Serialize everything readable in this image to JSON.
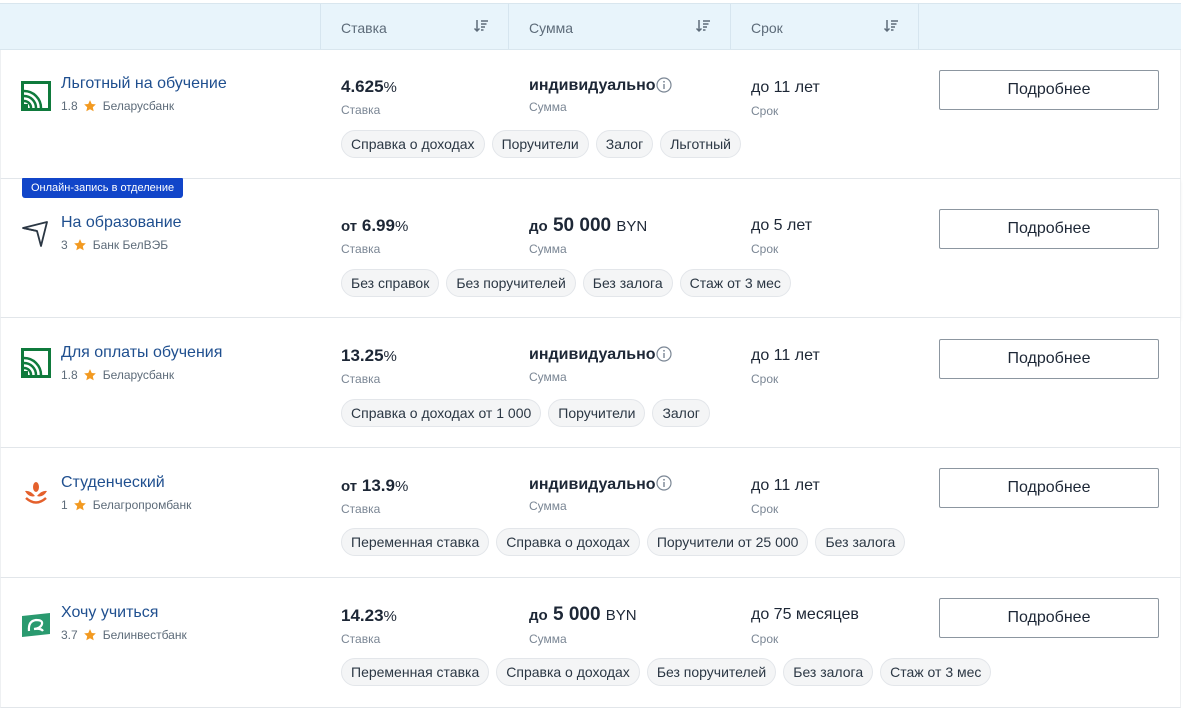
{
  "header": {
    "rate_label": "Ставка",
    "sum_label": "Сумма",
    "term_label": "Срок"
  },
  "colors": {
    "accent_blue": "#1145c9",
    "link_blue": "#1f4f8f",
    "header_bg": "#e8f4fb",
    "star": "#f29a21"
  },
  "rows": [
    {
      "name": "Льготный на обучение",
      "rating": "1.8",
      "bank": "Беларусбанк",
      "logo": "belarusbank-logo",
      "rate_prefix": "",
      "rate_value": "4.625",
      "rate_unit": "%",
      "rate_caption": "Ставка",
      "sum_prefix": "",
      "sum_value": "индивидуально",
      "sum_unit": "",
      "sum_caption": "Сумма",
      "term_value": "до 11 лет",
      "term_caption": "Срок",
      "button": "Подробнее",
      "chips": [
        "Справка о доходах",
        "Поручители",
        "Залог",
        "Льготный"
      ]
    },
    {
      "badge": "Онлайн-запись в отделение",
      "name": "На образование",
      "rating": "3",
      "bank": "Банк БелВЭБ",
      "logo": "belveb-logo",
      "rate_prefix": "от",
      "rate_value": "6.99",
      "rate_unit": "%",
      "rate_caption": "Ставка",
      "sum_prefix": "до",
      "sum_value": "50 000",
      "sum_unit": "BYN",
      "sum_caption": "Сумма",
      "term_value": "до 5 лет",
      "term_caption": "Срок",
      "button": "Подробнее",
      "chips": [
        "Без справок",
        "Без поручителей",
        "Без залога",
        "Стаж от 3 мес"
      ]
    },
    {
      "name": "Для оплаты обучения",
      "rating": "1.8",
      "bank": "Беларусбанк",
      "logo": "belarusbank-logo",
      "rate_prefix": "",
      "rate_value": "13.25",
      "rate_unit": "%",
      "rate_caption": "Ставка",
      "sum_prefix": "",
      "sum_value": "индивидуально",
      "sum_unit": "",
      "sum_caption": "Сумма",
      "term_value": "до 11 лет",
      "term_caption": "Срок",
      "button": "Подробнее",
      "chips": [
        "Справка о доходах от 1 000",
        "Поручители",
        "Залог"
      ]
    },
    {
      "name": "Студенческий",
      "rating": "1",
      "bank": "Белагропромбанк",
      "logo": "belagroprombank-logo",
      "rate_prefix": "от",
      "rate_value": "13.9",
      "rate_unit": "%",
      "rate_caption": "Ставка",
      "sum_prefix": "",
      "sum_value": "индивидуально",
      "sum_unit": "",
      "sum_caption": "Сумма",
      "term_value": "до 11 лет",
      "term_caption": "Срок",
      "button": "Подробнее",
      "chips": [
        "Переменная ставка",
        "Справка о доходах",
        "Поручители от 25 000",
        "Без залога"
      ]
    },
    {
      "name": "Хочу учиться",
      "rating": "3.7",
      "bank": "Белинвестбанк",
      "logo": "belinvestbank-logo",
      "rate_prefix": "",
      "rate_value": "14.23",
      "rate_unit": "%",
      "rate_caption": "Ставка",
      "sum_prefix": "до",
      "sum_value": "5 000",
      "sum_unit": "BYN",
      "sum_caption": "Сумма",
      "term_value": "до 75 месяцев",
      "term_caption": "Срок",
      "button": "Подробнее",
      "chips": [
        "Переменная ставка",
        "Справка о доходах",
        "Без поручителей",
        "Без залога",
        "Стаж от 3 мес"
      ]
    }
  ]
}
